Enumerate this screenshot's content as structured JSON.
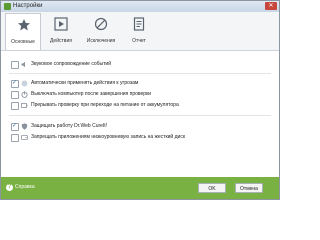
{
  "window": {
    "title": "Настройки"
  },
  "tabs": [
    {
      "label": "Основные",
      "icon": "star-icon",
      "active": true
    },
    {
      "label": "Действия",
      "icon": "play-icon",
      "active": false
    },
    {
      "label": "Исключения",
      "icon": "exclusion-icon",
      "active": false
    },
    {
      "label": "Отчет",
      "icon": "report-icon",
      "active": false
    }
  ],
  "options": [
    {
      "label": "Звуковое сопровождение событий",
      "checked": false,
      "icon": "sound-icon"
    },
    {
      "label": "Автоматически применять действия к угрозам",
      "checked": true,
      "icon": ""
    },
    {
      "label": "Выключать компьютер после завершения проверки",
      "checked": false,
      "icon": ""
    },
    {
      "label": "Прерывать проверку при переходе на питание от аккумулятора",
      "checked": false,
      "icon": ""
    },
    {
      "label": "Защищать работу Dr.Web CureIt!",
      "checked": true,
      "icon": "shield-icon"
    },
    {
      "label": "Запрещать приложениям низкоуровневую запись на жесткий диск",
      "checked": false,
      "icon": ""
    }
  ],
  "footer": {
    "help_label": "Справка",
    "ok_label": "OK",
    "cancel_label": "Отмена"
  },
  "colors": {
    "accent": "#79b142",
    "checkbox_tick": "#2f6aa8"
  }
}
